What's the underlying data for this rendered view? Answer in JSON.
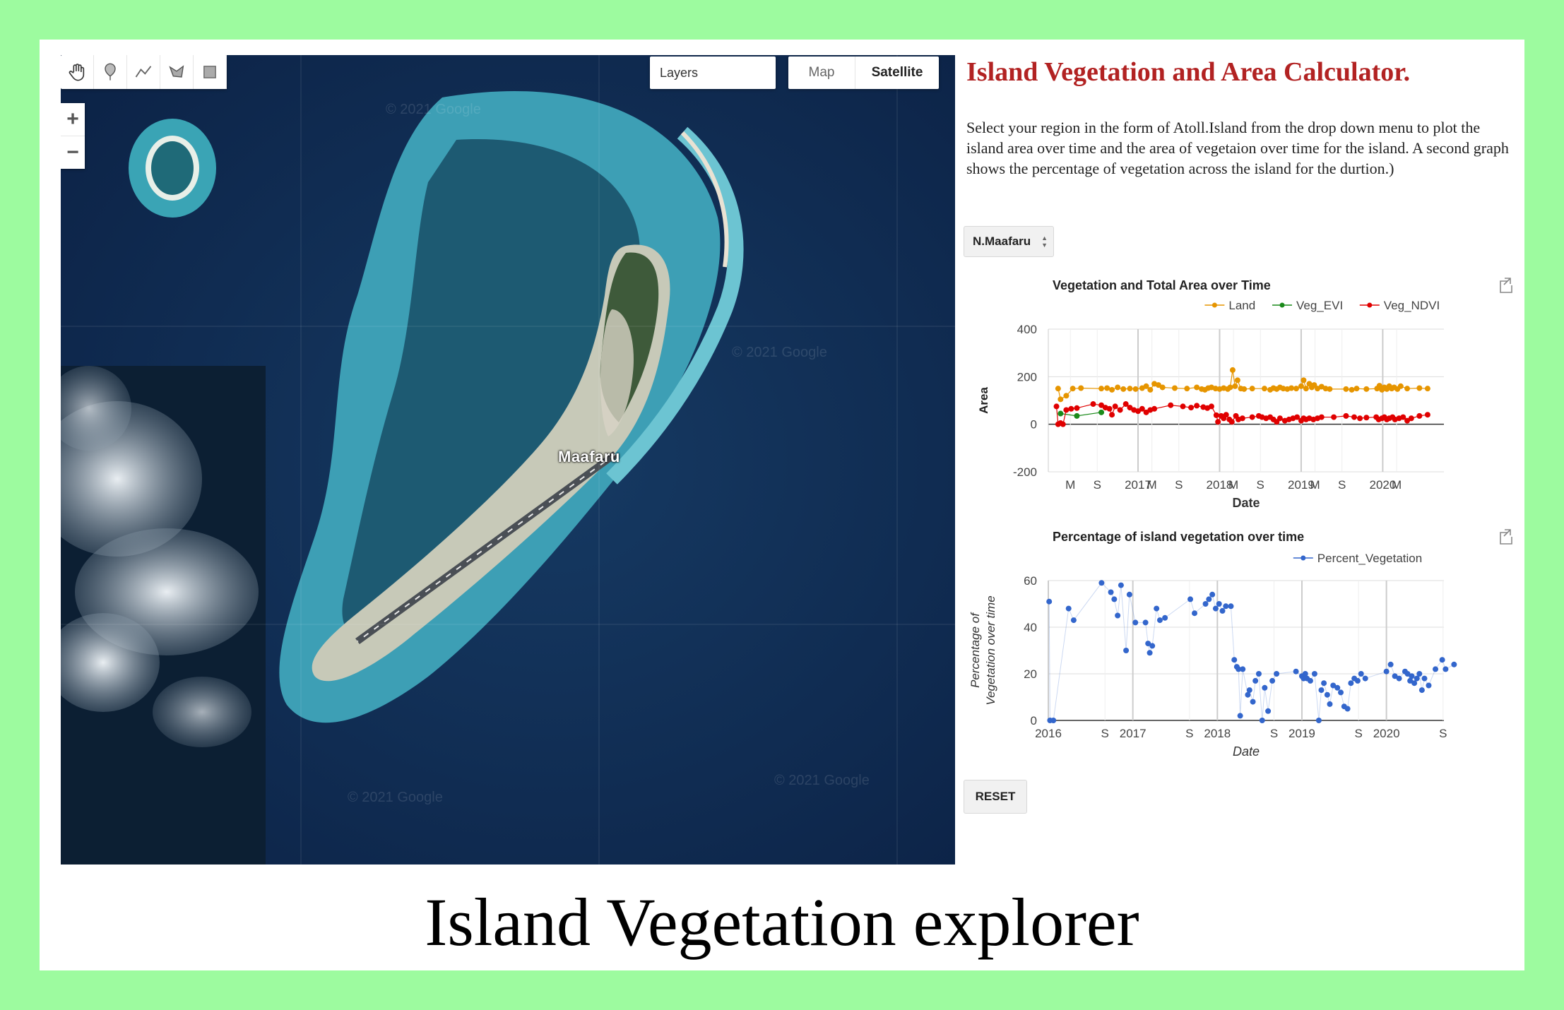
{
  "map": {
    "place_label": "Maafaru",
    "layers_label": "Layers",
    "map_type": {
      "map_label": "Map",
      "satellite_label": "Satellite",
      "selected": "Satellite"
    },
    "zoom_in": "+",
    "zoom_out": "−",
    "watermark": "© 2021 Google",
    "tools": [
      "hand-icon",
      "marker-icon",
      "polyline-icon",
      "polygon-icon",
      "rectangle-icon"
    ]
  },
  "panel": {
    "title": "Island Vegetation and Area Calculator.",
    "description": "Select your region in the form of Atoll.Island from the drop down menu to plot the island area over time and the area of vegetaion over time for the island. A second graph shows the percentage of vegetation across the island for the durtion.)",
    "select_value": "N.Maafaru",
    "reset_label": "RESET"
  },
  "caption": "Island Vegetation explorer",
  "colors": {
    "title": "#b22222",
    "land": "#e69500",
    "veg_evi": "#1a8a1a",
    "veg_ndvi": "#e00000",
    "percent": "#3366cc",
    "background": "#9dfb9f"
  },
  "chart_data": [
    {
      "type": "line",
      "title": "Vegetation and Total Area over Time",
      "xlabel": "Date",
      "ylabel": "Area",
      "ylim": [
        -200,
        400
      ],
      "yticks": [
        400,
        200,
        0,
        -200
      ],
      "xticks": [
        "M",
        "S",
        "2017",
        "M",
        "S",
        "2018",
        "M",
        "S",
        "2019",
        "M",
        "S",
        "2020",
        "M"
      ],
      "legend_position": "top-right",
      "series": [
        {
          "name": "Land",
          "color": "#e69500",
          "points": [
            [
              2016.02,
              150
            ],
            [
              2016.05,
              105
            ],
            [
              2016.12,
              120
            ],
            [
              2016.2,
              150
            ],
            [
              2016.3,
              152
            ],
            [
              2016.55,
              150
            ],
            [
              2016.62,
              152
            ],
            [
              2016.68,
              145
            ],
            [
              2016.75,
              155
            ],
            [
              2016.82,
              148
            ],
            [
              2016.9,
              150
            ],
            [
              2016.97,
              148
            ],
            [
              2017.05,
              152
            ],
            [
              2017.1,
              160
            ],
            [
              2017.15,
              145
            ],
            [
              2017.2,
              170
            ],
            [
              2017.25,
              165
            ],
            [
              2017.3,
              155
            ],
            [
              2017.45,
              152
            ],
            [
              2017.6,
              150
            ],
            [
              2017.72,
              155
            ],
            [
              2017.78,
              148
            ],
            [
              2017.82,
              145
            ],
            [
              2017.86,
              152
            ],
            [
              2017.9,
              155
            ],
            [
              2017.95,
              150
            ],
            [
              2018.0,
              148
            ],
            [
              2018.05,
              152
            ],
            [
              2018.1,
              148
            ],
            [
              2018.13,
              155
            ],
            [
              2018.16,
              228
            ],
            [
              2018.19,
              160
            ],
            [
              2018.22,
              185
            ],
            [
              2018.26,
              150
            ],
            [
              2018.3,
              148
            ],
            [
              2018.4,
              150
            ],
            [
              2018.55,
              150
            ],
            [
              2018.62,
              145
            ],
            [
              2018.66,
              152
            ],
            [
              2018.7,
              148
            ],
            [
              2018.74,
              155
            ],
            [
              2018.78,
              150
            ],
            [
              2018.83,
              148
            ],
            [
              2018.88,
              152
            ],
            [
              2018.94,
              150
            ],
            [
              2019.0,
              160
            ],
            [
              2019.03,
              185
            ],
            [
              2019.06,
              150
            ],
            [
              2019.1,
              170
            ],
            [
              2019.13,
              155
            ],
            [
              2019.16,
              165
            ],
            [
              2019.2,
              150
            ],
            [
              2019.25,
              158
            ],
            [
              2019.3,
              150
            ],
            [
              2019.35,
              148
            ],
            [
              2019.55,
              148
            ],
            [
              2019.62,
              145
            ],
            [
              2019.68,
              150
            ],
            [
              2019.8,
              148
            ],
            [
              2019.93,
              150
            ],
            [
              2019.96,
              162
            ],
            [
              2019.99,
              145
            ],
            [
              2020.02,
              155
            ],
            [
              2020.05,
              148
            ],
            [
              2020.08,
              160
            ],
            [
              2020.11,
              150
            ],
            [
              2020.14,
              155
            ],
            [
              2020.18,
              148
            ],
            [
              2020.22,
              160
            ],
            [
              2020.3,
              150
            ],
            [
              2020.45,
              152
            ],
            [
              2020.55,
              150
            ]
          ]
        },
        {
          "name": "Veg_EVI",
          "color": "#1a8a1a",
          "points": [
            [
              2016.05,
              45
            ],
            [
              2016.25,
              35
            ],
            [
              2016.55,
              50
            ]
          ]
        },
        {
          "name": "Veg_NDVI",
          "color": "#e00000",
          "points": [
            [
              2016.0,
              75
            ],
            [
              2016.02,
              0
            ],
            [
              2016.05,
              5
            ],
            [
              2016.08,
              0
            ],
            [
              2016.12,
              60
            ],
            [
              2016.18,
              65
            ],
            [
              2016.25,
              68
            ],
            [
              2016.45,
              85
            ],
            [
              2016.55,
              80
            ],
            [
              2016.6,
              70
            ],
            [
              2016.65,
              65
            ],
            [
              2016.68,
              40
            ],
            [
              2016.72,
              75
            ],
            [
              2016.78,
              60
            ],
            [
              2016.85,
              85
            ],
            [
              2016.9,
              70
            ],
            [
              2016.95,
              60
            ],
            [
              2017.0,
              55
            ],
            [
              2017.05,
              65
            ],
            [
              2017.1,
              50
            ],
            [
              2017.15,
              60
            ],
            [
              2017.2,
              65
            ],
            [
              2017.4,
              80
            ],
            [
              2017.55,
              75
            ],
            [
              2017.65,
              70
            ],
            [
              2017.72,
              78
            ],
            [
              2017.8,
              72
            ],
            [
              2017.85,
              68
            ],
            [
              2017.9,
              75
            ],
            [
              2017.96,
              38
            ],
            [
              2017.98,
              10
            ],
            [
              2018.02,
              35
            ],
            [
              2018.05,
              25
            ],
            [
              2018.08,
              40
            ],
            [
              2018.12,
              20
            ],
            [
              2018.15,
              10
            ],
            [
              2018.2,
              35
            ],
            [
              2018.23,
              20
            ],
            [
              2018.28,
              25
            ],
            [
              2018.4,
              30
            ],
            [
              2018.48,
              35
            ],
            [
              2018.52,
              30
            ],
            [
              2018.57,
              25
            ],
            [
              2018.62,
              30
            ],
            [
              2018.66,
              20
            ],
            [
              2018.7,
              10
            ],
            [
              2018.74,
              25
            ],
            [
              2018.8,
              15
            ],
            [
              2018.85,
              20
            ],
            [
              2018.9,
              25
            ],
            [
              2018.95,
              30
            ],
            [
              2019.0,
              15
            ],
            [
              2019.03,
              25
            ],
            [
              2019.06,
              20
            ],
            [
              2019.1,
              25
            ],
            [
              2019.15,
              20
            ],
            [
              2019.2,
              25
            ],
            [
              2019.25,
              30
            ],
            [
              2019.4,
              30
            ],
            [
              2019.55,
              35
            ],
            [
              2019.65,
              30
            ],
            [
              2019.72,
              25
            ],
            [
              2019.8,
              28
            ],
            [
              2019.92,
              30
            ],
            [
              2019.95,
              20
            ],
            [
              2019.99,
              25
            ],
            [
              2020.02,
              30
            ],
            [
              2020.05,
              20
            ],
            [
              2020.08,
              25
            ],
            [
              2020.12,
              30
            ],
            [
              2020.15,
              20
            ],
            [
              2020.2,
              25
            ],
            [
              2020.25,
              30
            ],
            [
              2020.3,
              15
            ],
            [
              2020.35,
              25
            ],
            [
              2020.45,
              35
            ],
            [
              2020.55,
              40
            ]
          ]
        }
      ]
    },
    {
      "type": "scatter",
      "title": "Percentage of island vegetation over time",
      "xlabel": "Date",
      "ylabel": "Percentage of Vegetation over time",
      "ylim": [
        0,
        60
      ],
      "yticks": [
        60,
        40,
        20,
        0
      ],
      "xticks": [
        "2016",
        "S",
        "2017",
        "S",
        "2018",
        "S",
        "2019",
        "S",
        "2020",
        "S"
      ],
      "legend_position": "top-right",
      "series": [
        {
          "name": "Percent_Vegetation",
          "color": "#3366cc",
          "points": [
            [
              2016.01,
              51
            ],
            [
              2016.02,
              0
            ],
            [
              2016.06,
              0
            ],
            [
              2016.24,
              48
            ],
            [
              2016.3,
              43
            ],
            [
              2016.63,
              59
            ],
            [
              2016.74,
              55
            ],
            [
              2016.78,
              52
            ],
            [
              2016.82,
              45
            ],
            [
              2016.86,
              58
            ],
            [
              2016.92,
              30
            ],
            [
              2016.96,
              54
            ],
            [
              2017.03,
              42
            ],
            [
              2017.15,
              42
            ],
            [
              2017.18,
              33
            ],
            [
              2017.2,
              29
            ],
            [
              2017.23,
              32
            ],
            [
              2017.28,
              48
            ],
            [
              2017.32,
              43
            ],
            [
              2017.38,
              44
            ],
            [
              2017.68,
              52
            ],
            [
              2017.73,
              46
            ],
            [
              2017.86,
              50
            ],
            [
              2017.9,
              52
            ],
            [
              2017.94,
              54
            ],
            [
              2017.98,
              48
            ],
            [
              2018.02,
              50
            ],
            [
              2018.06,
              47
            ],
            [
              2018.1,
              49
            ],
            [
              2018.16,
              49
            ],
            [
              2018.2,
              26
            ],
            [
              2018.23,
              23
            ],
            [
              2018.25,
              22
            ],
            [
              2018.27,
              2
            ],
            [
              2018.3,
              22
            ],
            [
              2018.36,
              11
            ],
            [
              2018.38,
              13
            ],
            [
              2018.42,
              8
            ],
            [
              2018.45,
              17
            ],
            [
              2018.49,
              20
            ],
            [
              2018.53,
              0
            ],
            [
              2018.56,
              14
            ],
            [
              2018.6,
              4
            ],
            [
              2018.65,
              17
            ],
            [
              2018.7,
              20
            ],
            [
              2018.93,
              21
            ],
            [
              2019.0,
              19
            ],
            [
              2019.02,
              18
            ],
            [
              2019.04,
              20
            ],
            [
              2019.06,
              18
            ],
            [
              2019.1,
              17
            ],
            [
              2019.15,
              20
            ],
            [
              2019.2,
              0
            ],
            [
              2019.23,
              13
            ],
            [
              2019.26,
              16
            ],
            [
              2019.3,
              11
            ],
            [
              2019.33,
              7
            ],
            [
              2019.37,
              15
            ],
            [
              2019.42,
              14
            ],
            [
              2019.46,
              12
            ],
            [
              2019.5,
              6
            ],
            [
              2019.54,
              5
            ],
            [
              2019.58,
              16
            ],
            [
              2019.62,
              18
            ],
            [
              2019.66,
              17
            ],
            [
              2019.7,
              20
            ],
            [
              2019.75,
              18
            ],
            [
              2020.0,
              21
            ],
            [
              2020.05,
              24
            ],
            [
              2020.1,
              19
            ],
            [
              2020.15,
              18
            ],
            [
              2020.22,
              21
            ],
            [
              2020.25,
              20
            ],
            [
              2020.28,
              17
            ],
            [
              2020.3,
              19
            ],
            [
              2020.33,
              16
            ],
            [
              2020.36,
              18
            ],
            [
              2020.39,
              20
            ],
            [
              2020.42,
              13
            ],
            [
              2020.45,
              18
            ],
            [
              2020.5,
              15
            ],
            [
              2020.58,
              22
            ],
            [
              2020.66,
              26
            ],
            [
              2020.7,
              22
            ],
            [
              2020.8,
              24
            ]
          ]
        }
      ]
    }
  ]
}
